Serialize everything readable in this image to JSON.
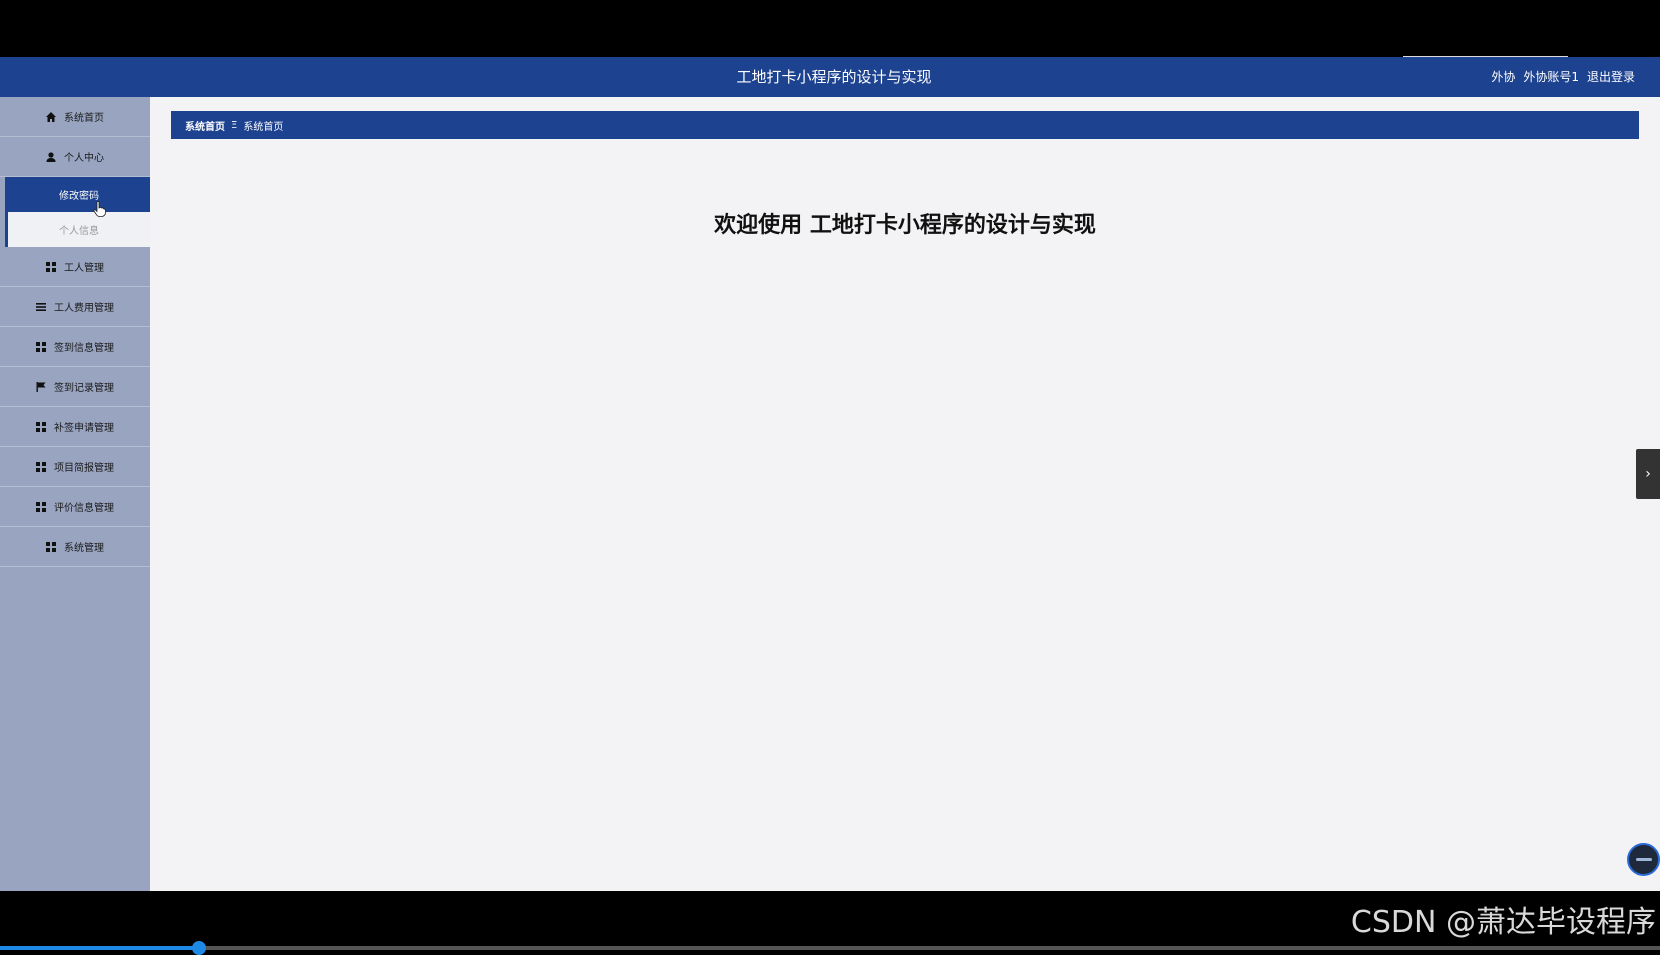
{
  "header": {
    "title": "工地打卡小程序的设计与实现",
    "user_role": "外协",
    "user_name": "外协账号1",
    "logout_label": "退出登录"
  },
  "sidebar": {
    "items": [
      {
        "label": "系统首页",
        "icon": "home-icon"
      },
      {
        "label": "个人中心",
        "icon": "user-icon"
      },
      {
        "label": "修改密码",
        "sub": true,
        "active": true
      },
      {
        "label": "个人信息",
        "sub": true,
        "active": false
      },
      {
        "label": "工人管理",
        "icon": "grid-icon"
      },
      {
        "label": "工人费用管理",
        "icon": "list-icon"
      },
      {
        "label": "签到信息管理",
        "icon": "grid-icon"
      },
      {
        "label": "签到记录管理",
        "icon": "flag-icon"
      },
      {
        "label": "补签申请管理",
        "icon": "grid-icon"
      },
      {
        "label": "项目简报管理",
        "icon": "grid-icon"
      },
      {
        "label": "评价信息管理",
        "icon": "grid-icon"
      },
      {
        "label": "系统管理",
        "icon": "grid-icon"
      }
    ]
  },
  "breadcrumb": {
    "home": "系统首页",
    "separator": "Ξ",
    "current": "系统首页"
  },
  "main": {
    "welcome": "欢迎使用 工地打卡小程序的设计与实现"
  },
  "watermark": "CSDN @萧达毕设程序",
  "video_progress": 0.12,
  "colors": {
    "primary": "#1d4290",
    "sidebar_bg": "#98a4c0",
    "content_bg": "#f3f3f5"
  }
}
